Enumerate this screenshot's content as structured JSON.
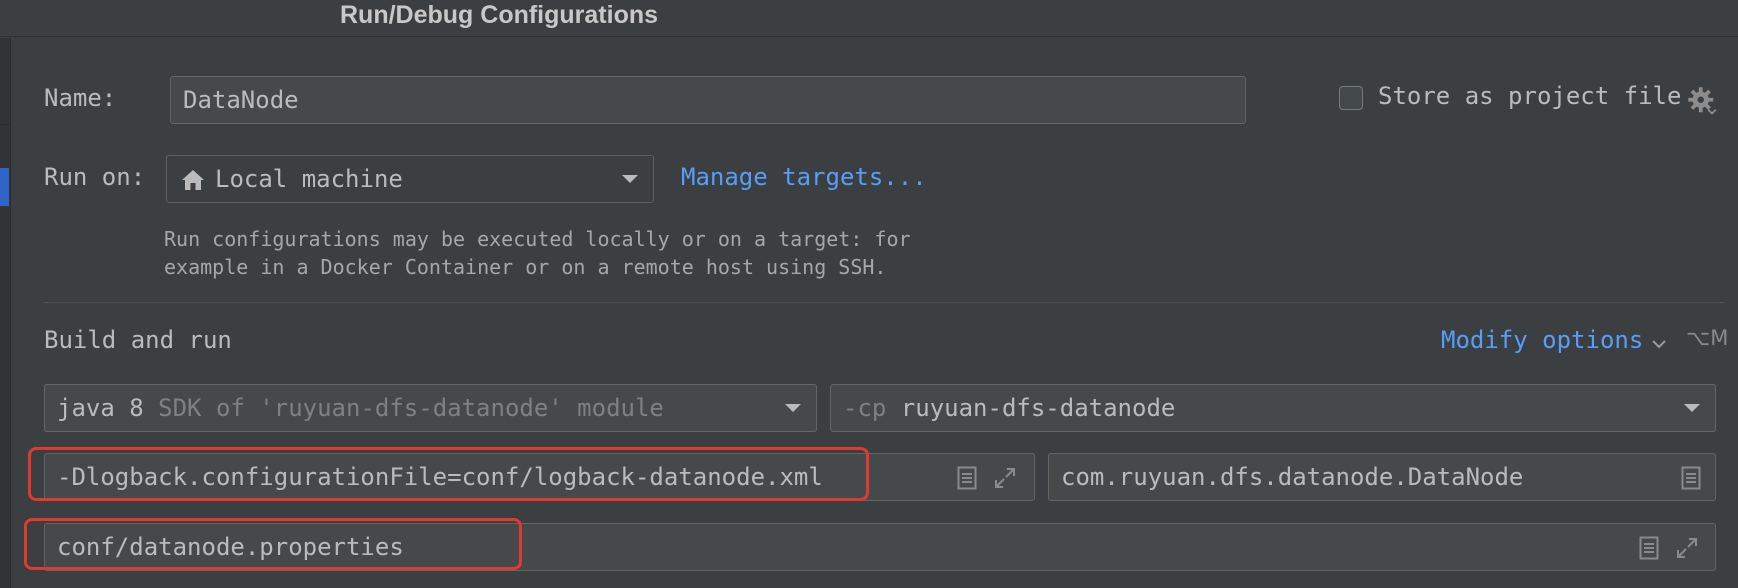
{
  "window": {
    "title": "Run/Debug Configurations"
  },
  "form": {
    "name_label": "Name:",
    "name_value": "DataNode",
    "store_label": "Store as project file",
    "store_checked": false,
    "run_on_label": "Run on:",
    "run_on_value": "Local machine",
    "manage_targets": "Manage targets...",
    "hint_line1": "Run configurations may be executed locally or on a target: for",
    "hint_line2": "example in a Docker Container or on a remote host using SSH."
  },
  "build": {
    "section_title": "Build and run",
    "modify_options": "Modify options",
    "modify_shortcut": "⌥M",
    "jdk_name": "java 8",
    "jdk_desc": "SDK of 'ruyuan-dfs-datanode' module",
    "cp_flag": "-cp",
    "cp_value": "ruyuan-dfs-datanode",
    "vm_options": "-Dlogback.configurationFile=conf/logback-datanode.xml",
    "main_class": "com.ruyuan.dfs.datanode.DataNode",
    "program_args": "conf/datanode.properties"
  },
  "colors": {
    "background": "#3c3f41",
    "field_bg": "#45494a",
    "link": "#589df6",
    "highlight": "#e03a2e",
    "selection": "#2f65ca"
  },
  "icons": [
    "home-icon",
    "chevron-down-icon",
    "gear-icon",
    "document-icon",
    "expand-icon"
  ]
}
